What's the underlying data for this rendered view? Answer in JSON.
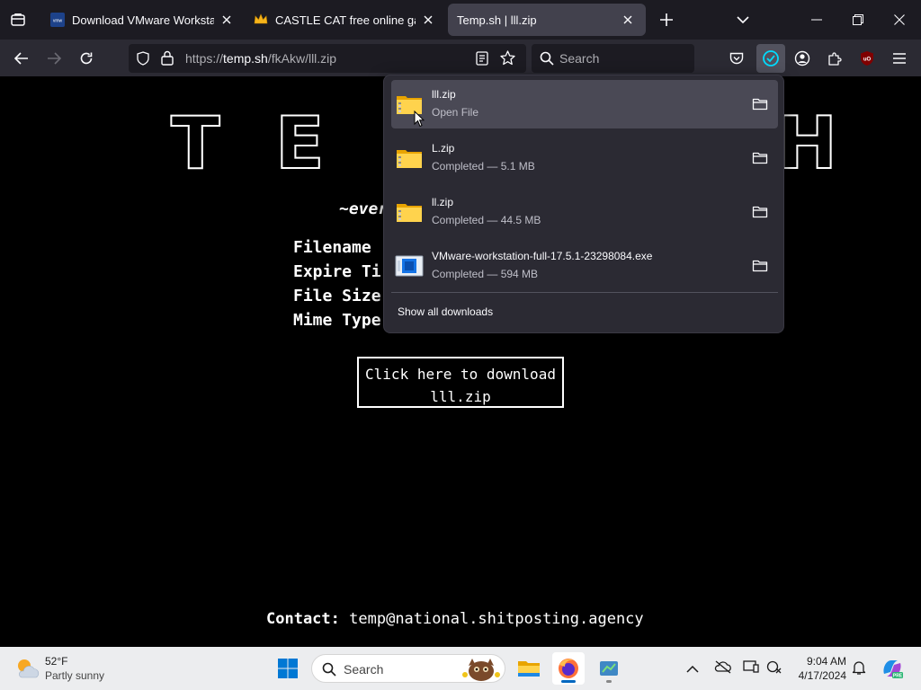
{
  "tabs": [
    {
      "title": "Download VMware Workstation",
      "favicon": "vmware-logo-icon",
      "active": false
    },
    {
      "title": "CASTLE CAT free online game o",
      "favicon": "crown-icon",
      "active": false
    },
    {
      "title": "Temp.sh | lll.zip",
      "favicon": "none",
      "active": true
    }
  ],
  "navbar": {
    "url_prefix": "https://",
    "url_host": "temp.sh",
    "url_path": "/fkAkw/lll.zip",
    "search_placeholder": "Search"
  },
  "page": {
    "logo_letters": [
      "T",
      "E",
      "H"
    ],
    "tagline": "~ever",
    "info_labels": [
      "Filename",
      "Expire Ti",
      "File Size",
      "Mime Type"
    ],
    "download_button_line1": "Click here to download",
    "download_button_line2": "lll.zip",
    "contact_label": "Contact:",
    "contact_email": "temp@national.shitposting.agency"
  },
  "downloads_panel": {
    "items": [
      {
        "name": "lll.zip",
        "status": "Open File",
        "icon": "zip-folder-icon",
        "hover": true
      },
      {
        "name": "L.zip",
        "status": "Completed — 5.1 MB",
        "icon": "zip-folder-icon",
        "hover": false
      },
      {
        "name": "ll.zip",
        "status": "Completed — 44.5 MB",
        "icon": "zip-folder-icon",
        "hover": false
      },
      {
        "name": "VMware-workstation-full-17.5.1-23298084.exe",
        "status": "Completed — 594 MB",
        "icon": "installer-exe-icon",
        "hover": false
      }
    ],
    "show_all": "Show all downloads"
  },
  "taskbar": {
    "weather_temp": "52°F",
    "weather_desc": "Partly sunny",
    "search_placeholder": "Search",
    "time": "9:04 AM",
    "date": "4/17/2024"
  },
  "colors": {
    "browser_bg": "#1c1b22",
    "toolbar_bg": "#2b2a33",
    "active_tab": "#42414d",
    "accent": "#00ddff",
    "taskbar_bg": "#ecedef"
  }
}
